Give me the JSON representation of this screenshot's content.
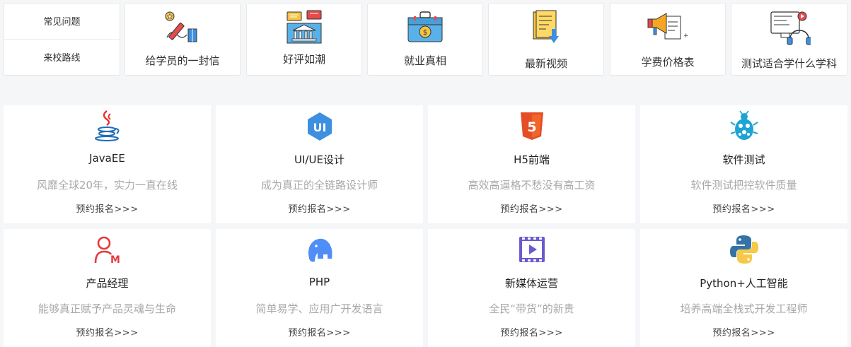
{
  "faq": {
    "common_questions": "常见问题",
    "route_to_school": "来校路线"
  },
  "top_cards": [
    {
      "label": "给学员的一封信",
      "icon": "letter-pen-icon"
    },
    {
      "label": "好评如潮",
      "icon": "praise-building-icon"
    },
    {
      "label": "就业真相",
      "icon": "briefcase-coin-icon"
    },
    {
      "label": "最新视频",
      "icon": "document-download-icon"
    },
    {
      "label": "学费价格表",
      "icon": "megaphone-scroll-icon"
    },
    {
      "label": "测试适合学什么学科",
      "icon": "computer-headphones-icon"
    }
  ],
  "courses": [
    {
      "title": "JavaEE",
      "desc": "风靡全球20年，实力一直在线",
      "link": "预约报名>>>",
      "icon": "java-cup-icon"
    },
    {
      "title": "UI/UE设计",
      "desc": "成为真正的全链路设计师",
      "link": "预约报名>>>",
      "icon": "ui-hexagon-icon"
    },
    {
      "title": "H5前端",
      "desc": "高效高逼格不愁没有高工资",
      "link": "预约报名>>>",
      "icon": "html5-shield-icon"
    },
    {
      "title": "软件测试",
      "desc": "软件测试把控软件质量",
      "link": "预约报名>>>",
      "icon": "bug-icon"
    },
    {
      "title": "产品经理",
      "desc": "能够真正赋予产品灵魂与生命",
      "link": "预约报名>>>",
      "icon": "person-m-icon"
    },
    {
      "title": "PHP",
      "desc": "简单易学、应用广开发语言",
      "link": "预约报名>>>",
      "icon": "elephant-icon"
    },
    {
      "title": "新媒体运营",
      "desc": "全民“带货”的新贵",
      "link": "预约报名>>>",
      "icon": "video-film-icon"
    },
    {
      "title": "Python+人工智能",
      "desc": "培养高端全栈式开发工程师",
      "link": "预约报名>>>",
      "icon": "python-snakes-icon"
    }
  ],
  "colors": {
    "java_red": "#e8332a",
    "java_blue": "#1d6fb8",
    "ui_blue": "#3d8fe0",
    "html5_orange": "#e44d26",
    "bug_blue": "#1ea4d4",
    "pm_red": "#e63a3a",
    "php_blue": "#4f8ef7",
    "video_purple": "#6a5acd",
    "python_blue": "#3572a5",
    "python_yellow": "#f7c948"
  }
}
